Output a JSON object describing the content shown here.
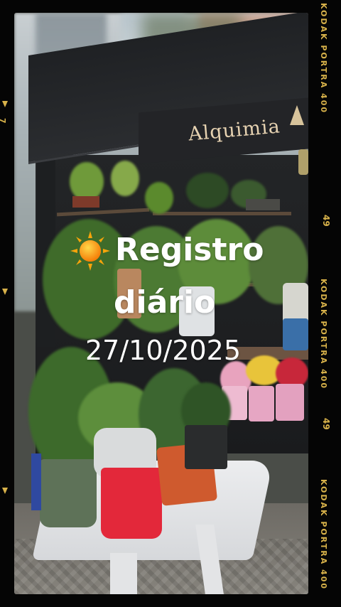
{
  "story": {
    "title_line_1": "Registro",
    "title_line_2": "diário",
    "date": "27/10/2025",
    "emoji": "sun-icon"
  },
  "scene": {
    "shop_sign": "Alquimia"
  },
  "film_frame": {
    "edge_labels": [
      "KODAK  PORTRA 400",
      "KODAK  PORTRA 400",
      "KODAK  PORTRA 400"
    ],
    "edge_numbers": [
      "49",
      "49"
    ],
    "left_number": "7",
    "accent_color": "#d8b24a"
  }
}
